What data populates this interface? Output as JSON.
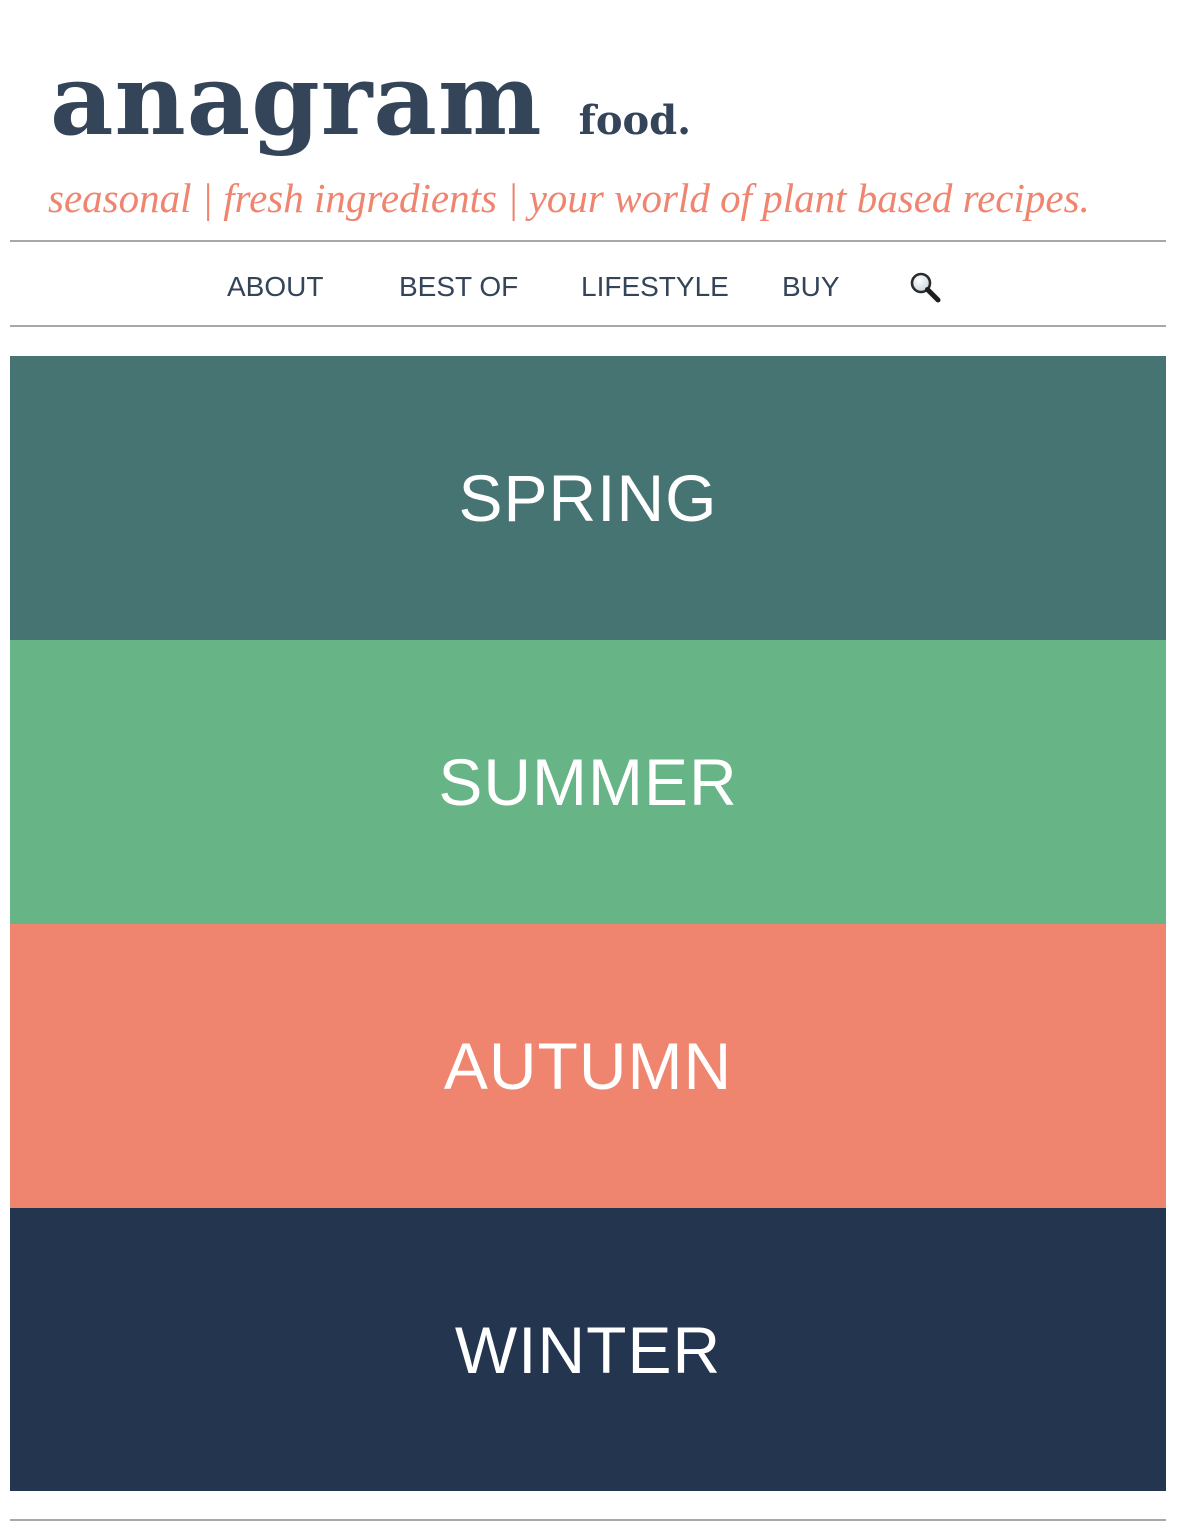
{
  "header": {
    "logo_main": "anagram",
    "logo_sub": "food.",
    "tagline": "seasonal | fresh ingredients | your world of plant based recipes."
  },
  "nav": {
    "items": [
      {
        "label": "ABOUT"
      },
      {
        "label": "BEST OF"
      },
      {
        "label": "LIFESTYLE"
      },
      {
        "label": "BUY"
      }
    ],
    "search_icon": "search-icon"
  },
  "seasons": [
    {
      "label": "SPRING",
      "color": "#467472"
    },
    {
      "label": "SUMMER",
      "color": "#67b486"
    },
    {
      "label": "AUTUMN",
      "color": "#ef846f"
    },
    {
      "label": "WINTER",
      "color": "#23354f"
    }
  ],
  "colors": {
    "brand_navy": "#34455a",
    "accent_coral": "#ef846f",
    "rule_gray": "#a8a8a8"
  }
}
